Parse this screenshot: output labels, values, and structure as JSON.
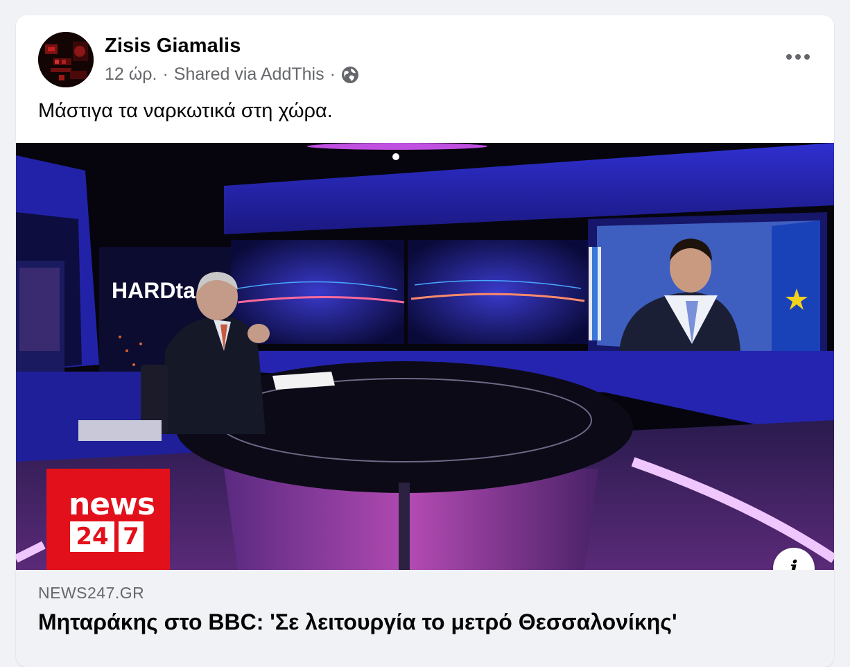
{
  "post": {
    "author": "Zisis Giamalis",
    "time": "12 ώρ.",
    "separator": "·",
    "shared_via": "Shared via AddThis",
    "audience_icon": "globe-icon",
    "more_icon": "more-options-icon",
    "text": "Μάστιγα τα ναρκωτικά στη χώρα."
  },
  "media": {
    "studio_sign": "HARDta",
    "logo_word": "news",
    "logo_num_a": "24",
    "logo_num_b": "7",
    "info_icon": "info-icon",
    "info_label": "i"
  },
  "link": {
    "domain": "NEWS247.GR",
    "title": "Μηταράκης στο BBC: 'Σε λειτουργία το μετρό Θεσσαλονίκης'"
  },
  "colors": {
    "page_bg": "#f0f2f5",
    "card_bg": "#ffffff",
    "text_primary": "#050505",
    "text_secondary": "#65676b",
    "news_red": "#e2101a"
  }
}
